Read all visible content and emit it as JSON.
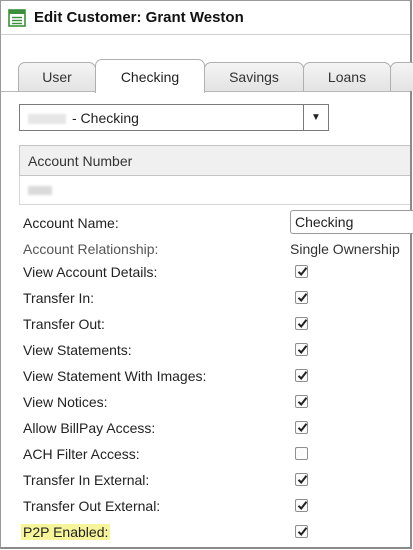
{
  "window": {
    "title": "Edit Customer: Grant Weston"
  },
  "tabs": [
    {
      "label": "User",
      "active": false
    },
    {
      "label": "Checking",
      "active": true
    },
    {
      "label": "Savings",
      "active": false
    },
    {
      "label": "Loans",
      "active": false
    }
  ],
  "account_select": {
    "value": "- Checking"
  },
  "account_table": {
    "header": "Account Number"
  },
  "fields": {
    "account_name": {
      "label": "Account Name:",
      "value": "Checking"
    },
    "account_relationship": {
      "label": "Account Relationship:",
      "value": "Single Ownership"
    }
  },
  "permissions": [
    {
      "label": "View Account Details:",
      "checked": true
    },
    {
      "label": "Transfer In:",
      "checked": true
    },
    {
      "label": "Transfer Out:",
      "checked": true
    },
    {
      "label": "View Statements:",
      "checked": true
    },
    {
      "label": "View Statement With Images:",
      "checked": true
    },
    {
      "label": "View Notices:",
      "checked": true
    },
    {
      "label": "Allow BillPay Access:",
      "checked": true
    },
    {
      "label": "ACH Filter Access:",
      "checked": false
    },
    {
      "label": "Transfer In External:",
      "checked": true
    },
    {
      "label": "Transfer Out External:",
      "checked": true
    },
    {
      "label": "P2P Enabled:",
      "checked": true,
      "highlighted": true
    }
  ],
  "colors": {
    "highlight": "#f7f59a",
    "icon_green": "#3a8f3a"
  }
}
